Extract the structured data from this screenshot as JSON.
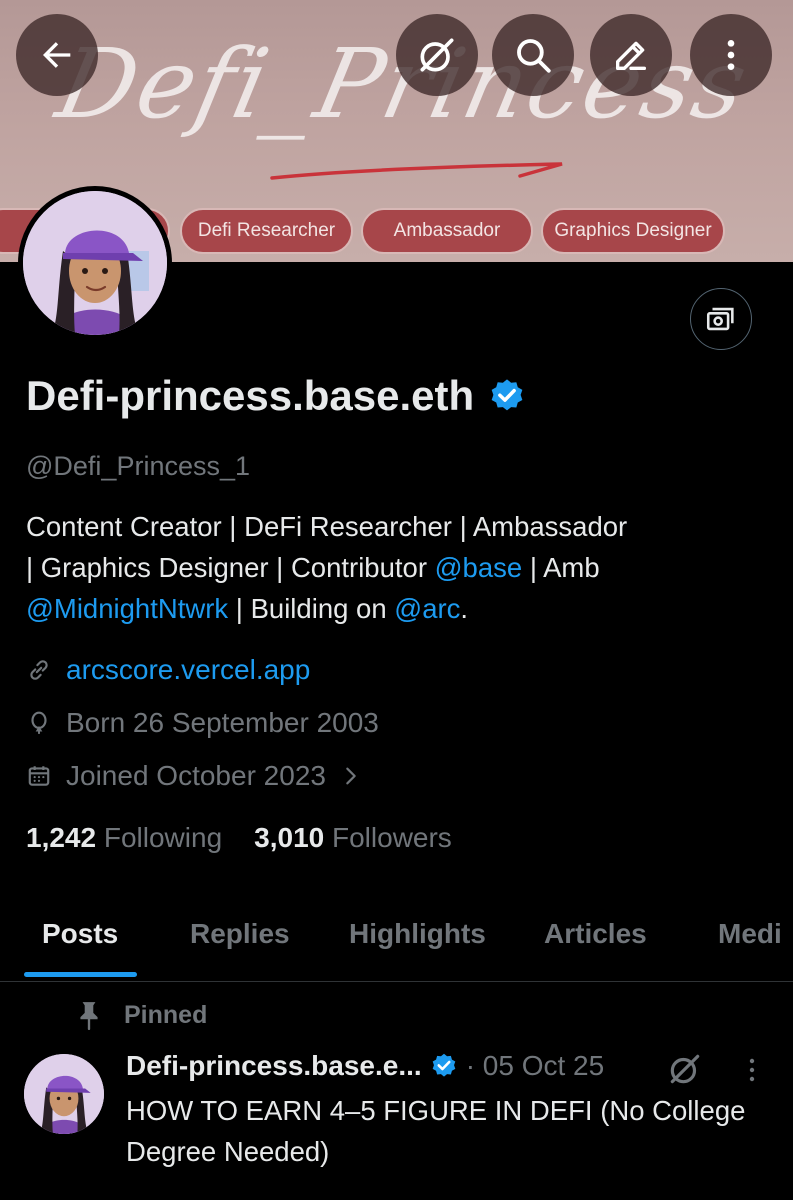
{
  "banner": {
    "title": "Defi_Princess",
    "chips": [
      "Defi Researcher",
      "Ambassador",
      "Graphics Designer"
    ]
  },
  "profile": {
    "display_name": "Defi-princess.base.eth",
    "handle": "@Defi_Princess_1",
    "bio": {
      "line1": "Content Creator | DeFi Researcher | Ambassador",
      "line2_a": "| Graphics Designer | Contributor ",
      "mention_base": "@base",
      "line2_b": " | Amb",
      "mention_midnight": "@MidnightNtwrk",
      "line3_a": " | Building on ",
      "mention_arc": "@arc",
      "line3_b": "."
    },
    "website": "arcscore.vercel.app",
    "birthday": "Born 26 September 2003",
    "joined": "Joined October 2023",
    "following_count": "1,242",
    "following_label": "Following",
    "followers_count": "3,010",
    "followers_label": "Followers"
  },
  "tabs": [
    "Posts",
    "Replies",
    "Highlights",
    "Articles",
    "Medi"
  ],
  "pinned_post": {
    "pinned_label": "Pinned",
    "author": "Defi-princess.base.e...",
    "date": "· 05 Oct 25",
    "text": "HOW TO EARN 4–5 FIGURE IN DEFI (No College Degree Needed)"
  },
  "icons": {
    "back": "arrow-left-icon",
    "grok": "grok-icon",
    "search": "search-icon",
    "edit": "edit-icon",
    "more": "more-vertical-icon",
    "subscriptions": "money-icon",
    "verified": "verified-badge-icon",
    "link": "link-icon",
    "birthday": "balloon-icon",
    "calendar": "calendar-icon",
    "pin": "pin-icon"
  },
  "colors": {
    "accent": "#1d9bf0",
    "muted": "#71767b",
    "text": "#e7e9ea",
    "chip": "#a7464a",
    "background": "#000000"
  }
}
